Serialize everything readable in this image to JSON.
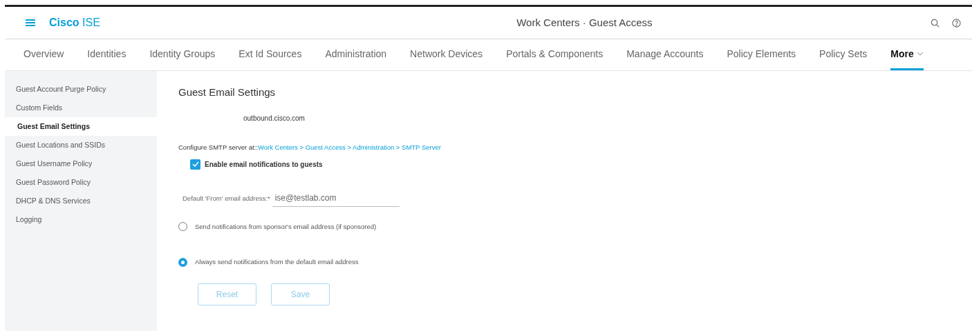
{
  "header": {
    "logo": "**Cisco** ISE",
    "title": "Work Centers · Guest Access"
  },
  "tabs": [
    {
      "label": "Overview",
      "selected": false
    },
    {
      "label": "Identities",
      "selected": false
    },
    {
      "label": "Identity Groups",
      "selected": false
    },
    {
      "label": "Ext Id Sources",
      "selected": false
    },
    {
      "label": "Administration",
      "selected": false
    },
    {
      "label": "Network Devices",
      "selected": false
    },
    {
      "label": "Portals & Components",
      "selected": false
    },
    {
      "label": "Manage Accounts",
      "selected": false
    },
    {
      "label": "Policy Elements",
      "selected": false
    },
    {
      "label": "Policy Sets",
      "selected": false
    },
    {
      "label": "More",
      "selected": true
    }
  ],
  "sidebar": {
    "items": [
      {
        "label": "Guest Account Purge Policy",
        "selected": false
      },
      {
        "label": "Custom Fields",
        "selected": false
      },
      {
        "label": "Guest Email Settings",
        "selected": true
      },
      {
        "label": "Guest Locations and SSIDs",
        "selected": false
      },
      {
        "label": "Guest Username Policy",
        "selected": false
      },
      {
        "label": "Guest Password Policy",
        "selected": false
      },
      {
        "label": "DHCP & DNS Services",
        "selected": false
      },
      {
        "label": "Logging",
        "selected": false
      }
    ]
  },
  "main": {
    "title": "Guest Email Settings",
    "server": "outbound.cisco.com",
    "smtp_prefix": "Configure SMTP server at::",
    "smtp_link": "Work Centers > Guest Access > Administration > SMTP Server",
    "enable": {
      "label": "Enable email notifications to guests",
      "checked": true
    },
    "from_label": "Default 'From' email address:*",
    "from_value": "ise@testlab.com",
    "options": [
      {
        "label": "Send notifications from sponsor's email address (if sponsored)",
        "selected": false
      },
      {
        "label": "Always send notifications from the default email address",
        "selected": true
      }
    ],
    "buttons": [
      "Reset",
      "Save"
    ]
  }
}
